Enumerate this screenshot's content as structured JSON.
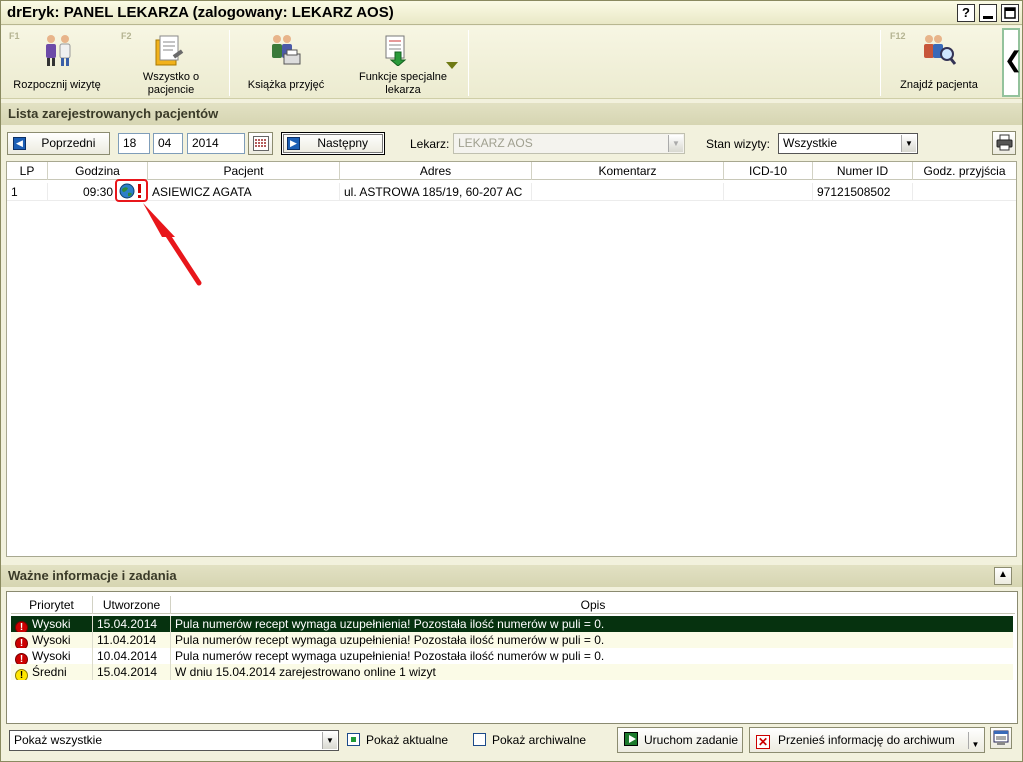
{
  "window": {
    "title": "drEryk: PANEL LEKARZA (zalogowany: LEKARZ AOS)",
    "help_label": "?"
  },
  "toolbar": {
    "start_visit": {
      "fkey": "F1",
      "label": "Rozpocznij wizytę"
    },
    "all_about_patient": {
      "fkey": "F2",
      "label": "Wszystko o pacjencie"
    },
    "admission_book": {
      "label": "Książka przyjęć"
    },
    "special_functions": {
      "label": "Funkcje specjalne lekarza"
    },
    "find_patient": {
      "fkey": "F12",
      "label": "Znajdź pacjenta"
    }
  },
  "patients_section": {
    "title": "Lista zarejestrowanych pacjentów"
  },
  "filters": {
    "prev_label": "Poprzedni",
    "day": "18",
    "month": "04",
    "year": "2014",
    "next_label": "Następny",
    "doctor_label": "Lekarz:",
    "doctor_value": "LEKARZ AOS",
    "visit_state_label": "Stan wizyty:",
    "visit_state_value": "Wszystkie"
  },
  "patients_table": {
    "columns": [
      "LP",
      "Godzina",
      "Pacjent",
      "Adres",
      "Komentarz",
      "ICD-10",
      "Numer ID",
      "Godz. przyjścia"
    ],
    "rows": [
      {
        "lp": "1",
        "time": "09:30",
        "patient": "ASIEWICZ AGATA",
        "address": "ul. ASTROWA 185/19, 60-207 AC",
        "comment": "",
        "icd": "",
        "id": "97121508502",
        "arrival": ""
      }
    ]
  },
  "info_section": {
    "title": "Ważne informacje i zadania",
    "columns": [
      "Priorytet",
      "Utworzone",
      "Opis"
    ],
    "rows": [
      {
        "priority": "Wysoki",
        "level": "high",
        "created": "15.04.2014",
        "desc": "Pula numerów recept wymaga uzupełnienia! Pozostała ilość numerów w puli = 0."
      },
      {
        "priority": "Wysoki",
        "level": "high",
        "created": "11.04.2014",
        "desc": "Pula numerów recept wymaga uzupełnienia! Pozostała ilość numerów w puli = 0."
      },
      {
        "priority": "Wysoki",
        "level": "high",
        "created": "10.04.2014",
        "desc": "Pula numerów recept wymaga uzupełnienia! Pozostała ilość numerów w puli = 0."
      },
      {
        "priority": "Średni",
        "level": "mid",
        "created": "15.04.2014",
        "desc": "W dniu 15.04.2014 zarejestrowano online 1 wizyt"
      }
    ],
    "filter_value": "Pokaż wszystkie",
    "show_current_label": "Pokaż aktualne",
    "show_current_checked": true,
    "show_archived_label": "Pokaż archiwalne",
    "show_archived_checked": false,
    "run_task_label": "Uruchom zadanie",
    "archive_label": "Przenieś informację do archiwum"
  },
  "colors": {
    "accent_green": "#06320f",
    "panel_bg": "#f2f1dd",
    "header_bg": "#dcdbb9",
    "arrow_red": "#e8161b"
  }
}
